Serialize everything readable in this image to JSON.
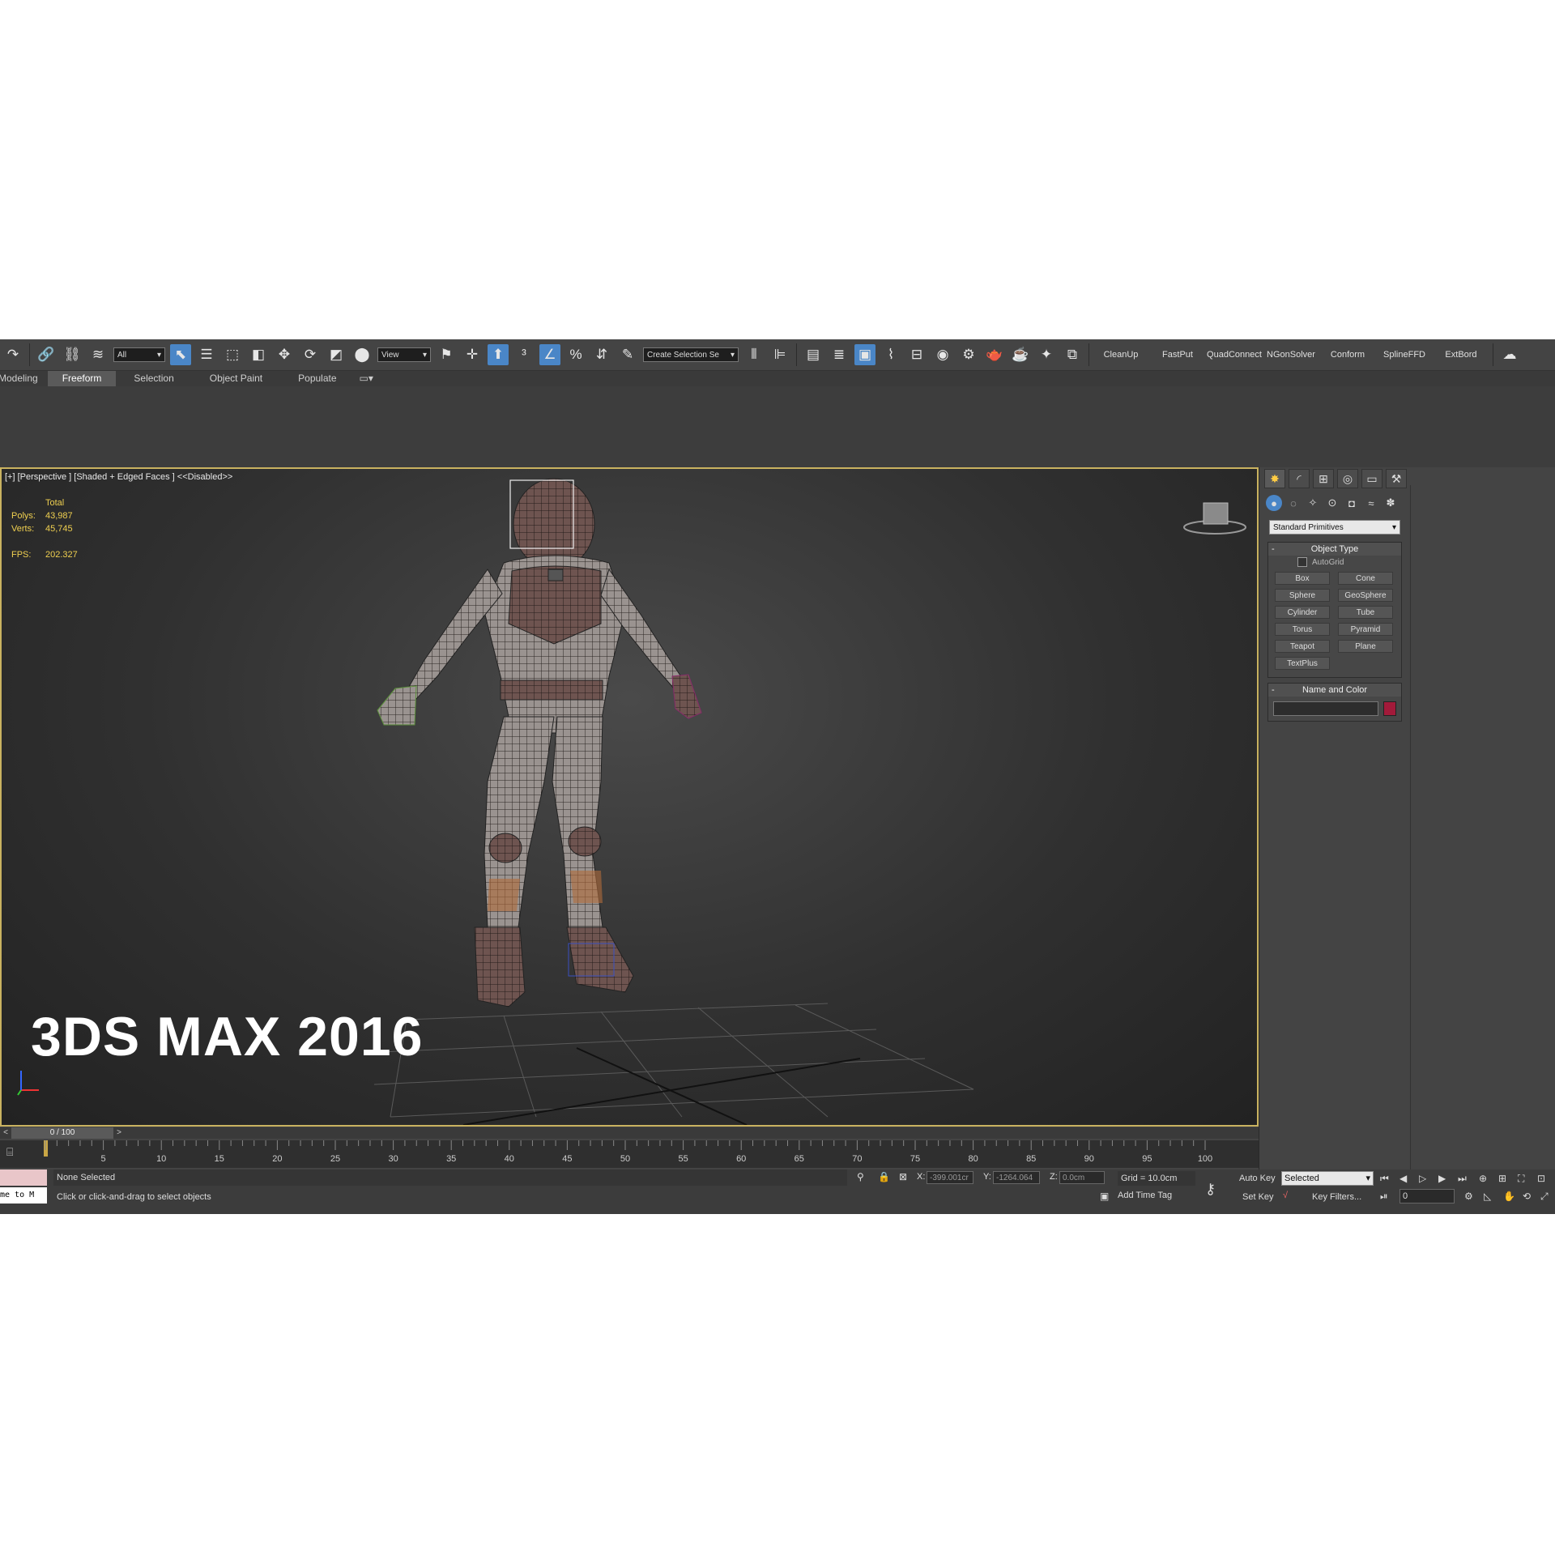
{
  "toolbar": {
    "selection_filter": "All",
    "ref_coord": "View",
    "named_sel_placeholder": "Create Selection Se",
    "plugin_buttons": [
      "CleanUp",
      "FastPut",
      "QuadConnect",
      "NGonSolver",
      "Conform",
      "SplineFFD",
      "ExtBord"
    ]
  },
  "ribbon": {
    "tabs": [
      "Modeling",
      "Freeform",
      "Selection",
      "Object Paint",
      "Populate"
    ],
    "active_tab": "Freeform"
  },
  "viewport": {
    "label": "[+] [Perspective ] [Shaded + Edged Faces ]  <<Disabled>>",
    "stats": {
      "total_label": "Total",
      "polys_label": "Polys:",
      "polys_value": "43,987",
      "verts_label": "Verts:",
      "verts_value": "45,745",
      "fps_label": "FPS:",
      "fps_value": "202.327"
    },
    "overlay_title": "3DS MAX 2016"
  },
  "command_panel": {
    "primitive_type": "Standard Primitives",
    "object_type_title": "Object Type",
    "autogrid_label": "AutoGrid",
    "object_buttons": [
      "Box",
      "Cone",
      "Sphere",
      "GeoSphere",
      "Cylinder",
      "Tube",
      "Torus",
      "Pyramid",
      "Teapot",
      "Plane",
      "TextPlus"
    ],
    "name_color_title": "Name and Color",
    "object_color": "#a21a3a"
  },
  "time_slider": {
    "prev": "<",
    "position": "0 / 100",
    "next": ">"
  },
  "trackbar": {
    "ticks": [
      "5",
      "10",
      "15",
      "20",
      "25",
      "30",
      "35",
      "40",
      "45",
      "50",
      "55",
      "60",
      "65",
      "70",
      "75",
      "80",
      "85",
      "90",
      "95",
      "100"
    ]
  },
  "status": {
    "maxscript_text": "me to M",
    "selection": "None Selected",
    "prompt": "Click or click-and-drag to select objects",
    "x_label": "X:",
    "x_value": "-399.001cr",
    "y_label": "Y:",
    "y_value": "-1264.064",
    "z_label": "Z:",
    "z_value": "0.0cm",
    "grid": "Grid = 10.0cm",
    "add_time_tag": "Add Time Tag",
    "auto_key": "Auto Key",
    "set_key": "Set Key",
    "key_mode": "Selected",
    "key_filters": "Key Filters...",
    "current_frame": "0"
  }
}
